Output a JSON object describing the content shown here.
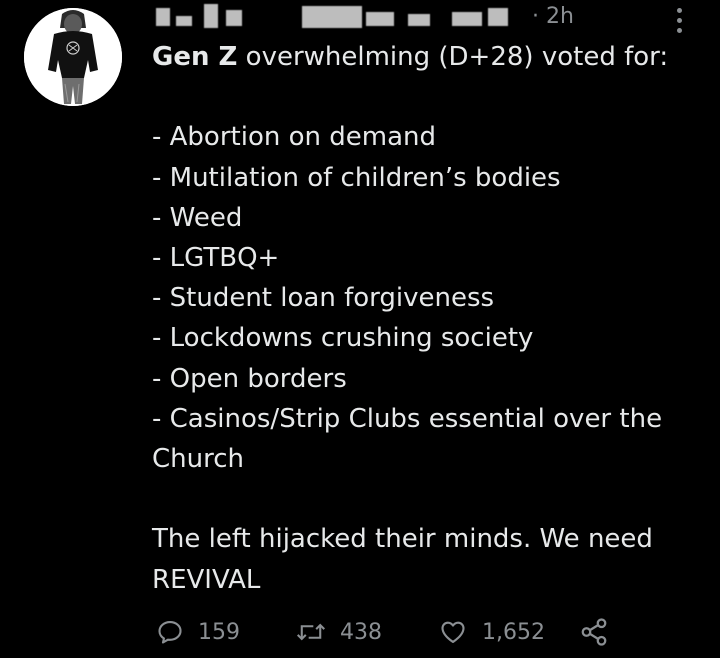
{
  "tweet": {
    "timestamp": "· 2h",
    "headline_bold": "Gen Z",
    "headline_rest": " overwhelming (D+28) voted for:",
    "list": [
      "- Abortion on demand",
      "- Mutilation of children’s bodies",
      "- Weed",
      "- LGTBQ+",
      "- Student loan forgiveness",
      "- Lockdowns crushing society",
      "- Open borders",
      "- Casinos/Strip Clubs essential over the Church"
    ],
    "closing": "The left hijacked their minds. We need REVIVAL"
  },
  "actions": {
    "reply_count": "159",
    "retweet_count": "438",
    "like_count": "1,652"
  },
  "icons": {
    "reply": "reply-icon",
    "retweet": "retweet-icon",
    "like": "heart-icon",
    "share": "share-icon",
    "more": "more-icon"
  },
  "colors": {
    "background": "#000000",
    "text": "#e7e9ea",
    "secondary": "#8b8f93"
  }
}
